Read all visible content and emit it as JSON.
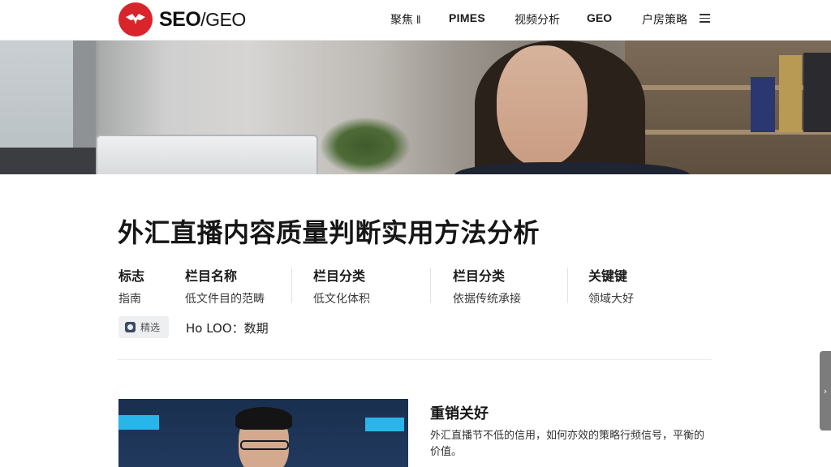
{
  "header": {
    "logo_text_bold": "SEO",
    "logo_text_rest": "/GEO",
    "nav": [
      "聚焦 ‖",
      "PIMES",
      "视频分析",
      "GEO",
      "户房策略"
    ],
    "logo_icon": "red-circle-logo-icon",
    "menu_icon": "hamburger-menu-icon"
  },
  "article": {
    "title": "外汇直播内容质量判断实用方法分析",
    "meta": [
      {
        "label": "标志",
        "value": "指南"
      },
      {
        "label": "栏目名称",
        "value": "低文件目的范畴"
      },
      {
        "label": "栏目分类",
        "value": "低文化体积"
      },
      {
        "label": "栏目分类",
        "value": "依据传统承接"
      },
      {
        "label": "关键键",
        "value": "领域大好"
      }
    ],
    "tag_button": "精选",
    "author": "Ho LOO：数期"
  },
  "card": {
    "title": "重销关好",
    "description": "外汇直播节不低的信用，如何亦效的策略行频信号，平衡的价值。"
  },
  "side_tab": {
    "label": "›"
  },
  "colors": {
    "brand": "#d8242a",
    "text": "#161616"
  }
}
